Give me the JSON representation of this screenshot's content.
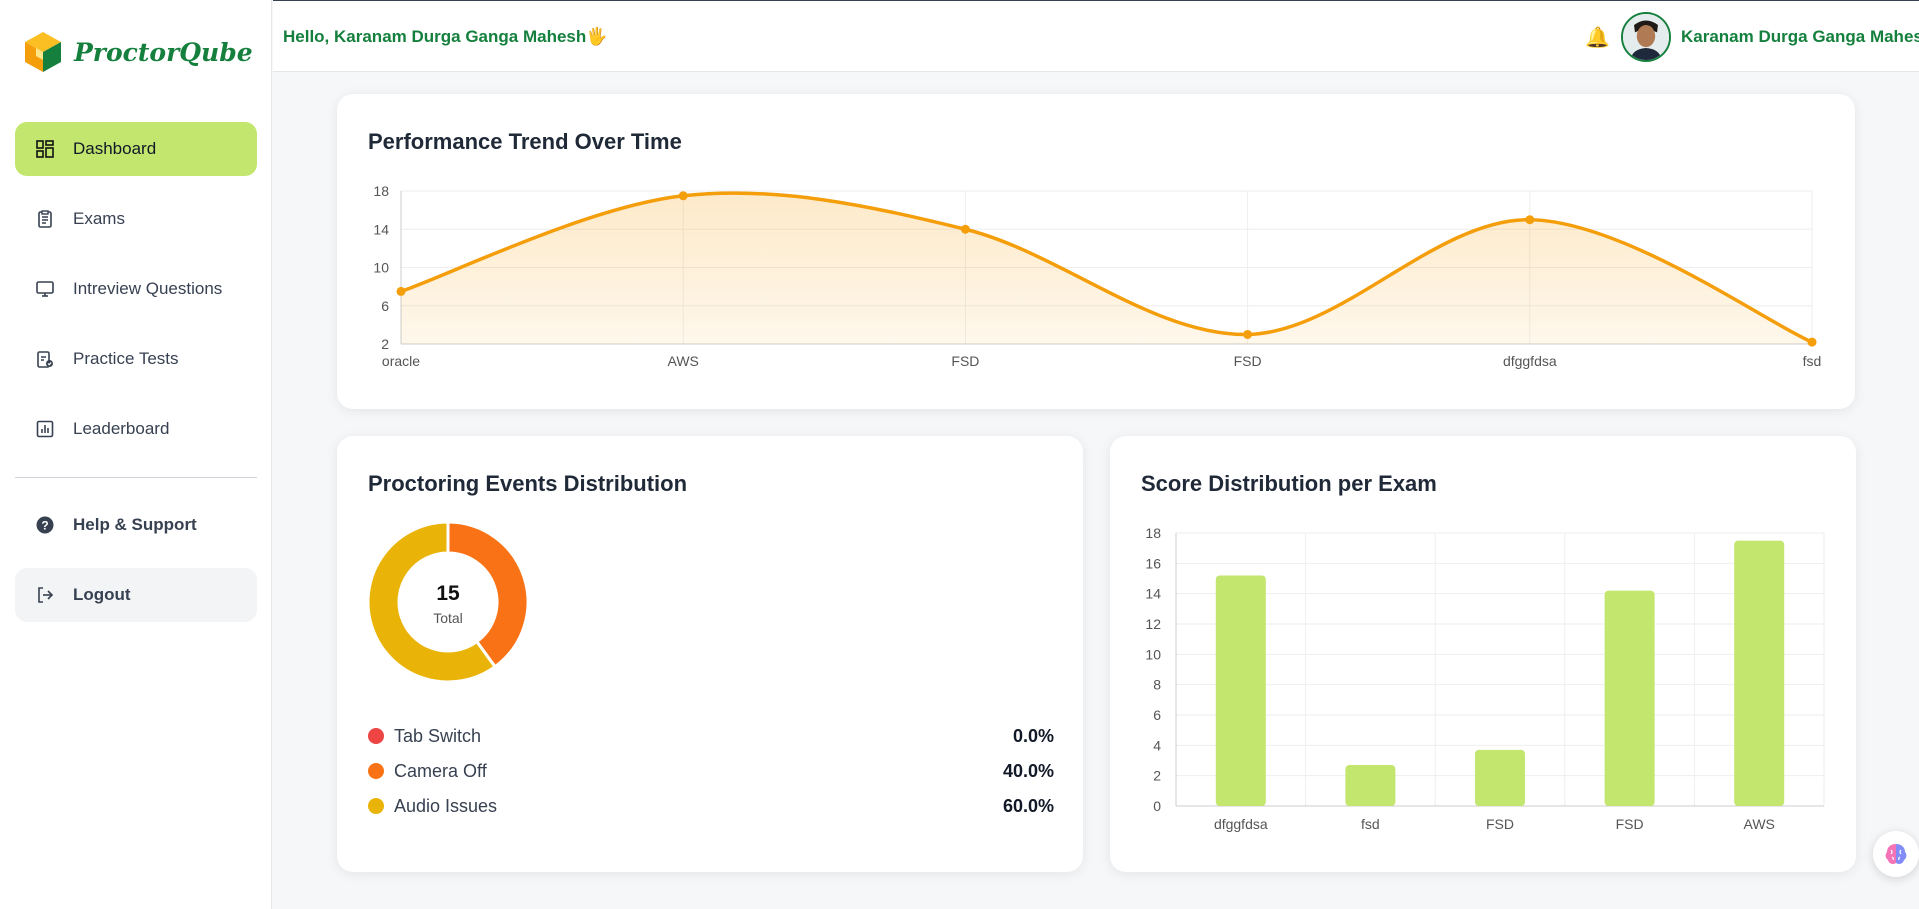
{
  "app": {
    "name": "ProctorQube"
  },
  "header": {
    "greeting": "Hello, Karanam Durga Ganga Mahesh",
    "greeting_emoji": "🖐",
    "bell": "🔔",
    "user_name": "Karanam Durga Ganga Mahesh"
  },
  "sidebar": {
    "items": [
      {
        "label": "Dashboard",
        "icon": "dashboard-icon",
        "active": true
      },
      {
        "label": "Exams",
        "icon": "clipboard-icon"
      },
      {
        "label": "Intreview Questions",
        "icon": "monitor-icon"
      },
      {
        "label": "Practice Tests",
        "icon": "clipboard-check-icon"
      },
      {
        "label": "Leaderboard",
        "icon": "bar-chart-icon"
      }
    ],
    "help": {
      "label": "Help & Support",
      "icon": "help-circle-icon"
    },
    "logout": {
      "label": "Logout",
      "icon": "logout-icon"
    }
  },
  "colors": {
    "brand_green": "#15803d",
    "active_bg": "#c2e66e",
    "trend_line": "#f59e0b",
    "bar": "#c2e66e",
    "tab_switch": "#ef4444",
    "camera_off": "#f97316",
    "audio_issues": "#eab308"
  },
  "cards": {
    "trend_title": "Performance Trend Over Time",
    "events_title": "Proctoring Events Distribution",
    "score_title": "Score Distribution per Exam"
  },
  "donut": {
    "total_value": "15",
    "total_label": "Total"
  },
  "chart_data": [
    {
      "type": "line",
      "title": "Performance Trend Over Time",
      "categories": [
        "oracle",
        "AWS",
        "FSD",
        "FSD",
        "dfggfdsa",
        "fsd"
      ],
      "series": [
        {
          "values": [
            7.5,
            17.5,
            14,
            3,
            15,
            2.2
          ]
        }
      ],
      "ylim": [
        2,
        18
      ],
      "yticks": [
        2,
        6,
        10,
        14,
        18
      ],
      "grid": true,
      "filled": true
    },
    {
      "type": "pie",
      "title": "Proctoring Events Distribution",
      "donut": true,
      "labels": [
        "Tab Switch",
        "Camera Off",
        "Audio Issues"
      ],
      "values": [
        0.0,
        40.0,
        60.0
      ],
      "display": [
        "0.0%",
        "40.0%",
        "60.0%"
      ],
      "legend": "bottom"
    },
    {
      "type": "bar",
      "title": "Score Distribution per Exam",
      "categories": [
        "dfggfdsa",
        "fsd",
        "FSD",
        "FSD",
        "AWS"
      ],
      "values": [
        15.2,
        2.7,
        3.7,
        14.2,
        17.5
      ],
      "ylim": [
        0,
        18
      ],
      "yticks": [
        0,
        2,
        4,
        6,
        8,
        10,
        12,
        14,
        16,
        18
      ],
      "grid": true
    }
  ]
}
